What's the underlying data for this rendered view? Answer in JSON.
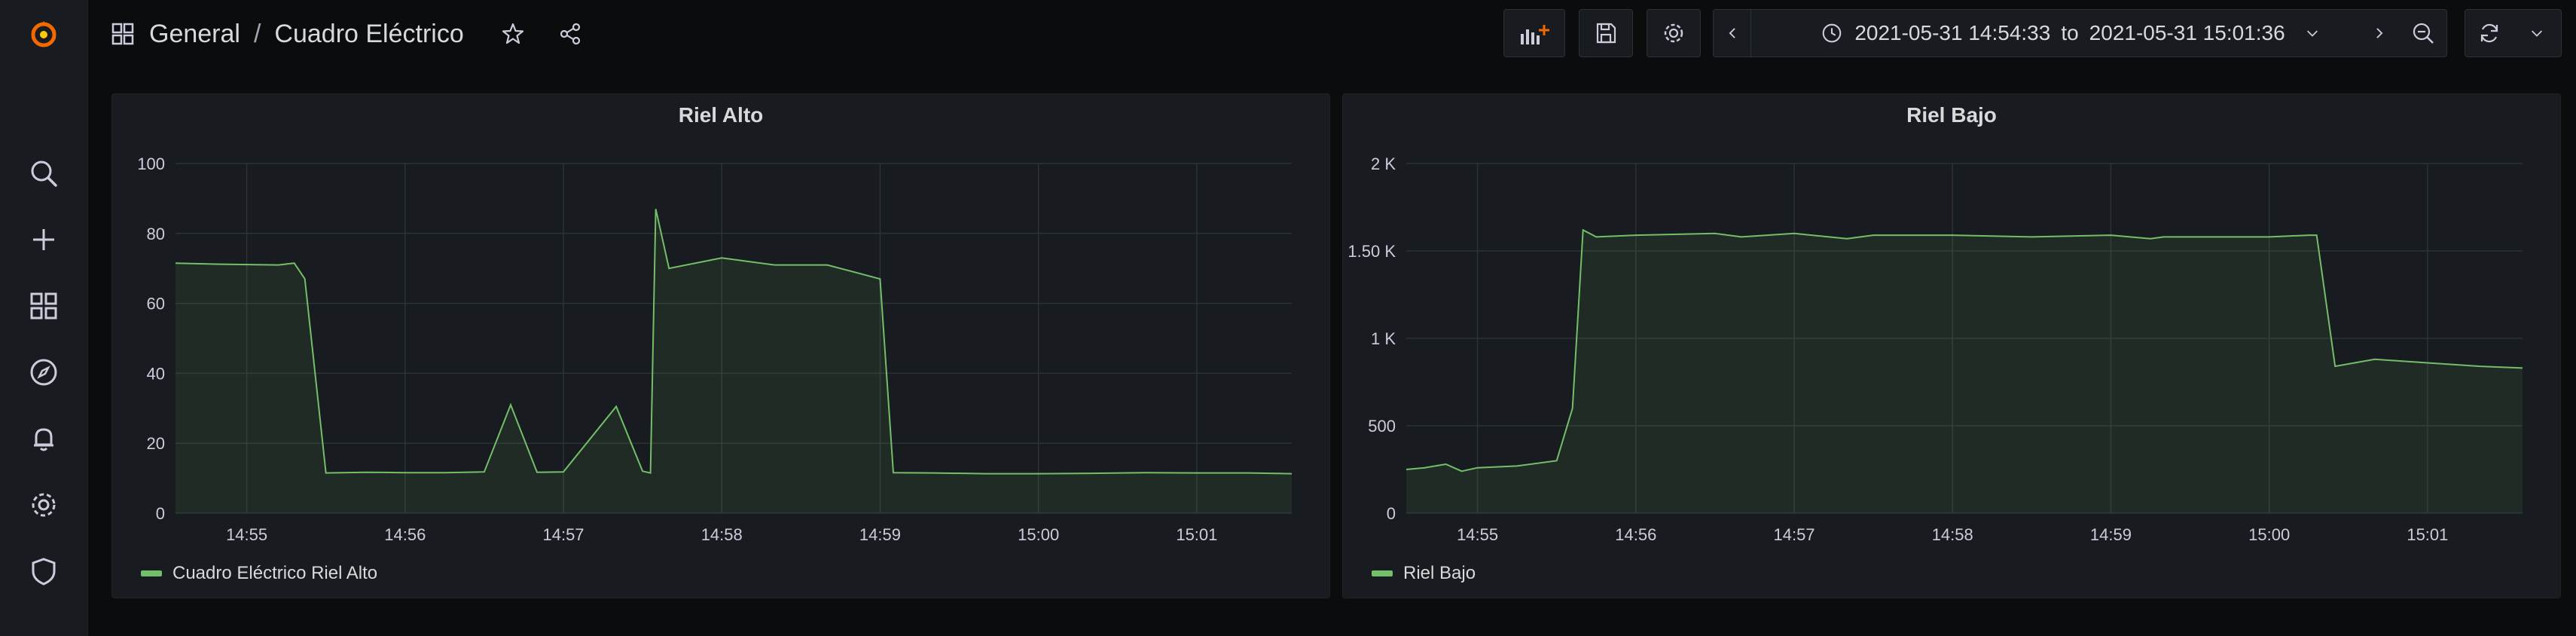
{
  "nav": {
    "items": [
      "search",
      "create",
      "dashboards",
      "explore",
      "alerting",
      "configuration",
      "server-admin"
    ]
  },
  "breadcrumb": {
    "folder": "General",
    "separator": "/",
    "dashboard": "Cuadro Eléctrico"
  },
  "time_range": {
    "from": "2021-05-31 14:54:33",
    "connector": "to",
    "to": "2021-05-31 15:01:36"
  },
  "colors": {
    "series": "#73bf69",
    "grid": "#2c3235",
    "panel_bg": "#181b1f",
    "page_bg": "#0b0c0e"
  },
  "panels": [
    {
      "title": "Riel Alto",
      "legend": "Cuadro Eléctrico Riel Alto"
    },
    {
      "title": "Riel Bajo",
      "legend": "Riel Bajo"
    }
  ],
  "chart_data": [
    {
      "type": "area",
      "title": "Riel Alto",
      "xlabel": "",
      "ylabel": "",
      "xlim": [
        "14:54:33",
        "15:01:36"
      ],
      "ylim": [
        0,
        100
      ],
      "x_ticks": [
        "14:55",
        "14:56",
        "14:57",
        "14:58",
        "14:59",
        "15:00",
        "15:01"
      ],
      "y_ticks": [
        "0",
        "20",
        "40",
        "60",
        "80",
        "100"
      ],
      "grid": true,
      "legend_position": "bottom-left",
      "series": [
        {
          "name": "Cuadro Eléctrico Riel Alto",
          "x": [
            "14:54:33",
            "14:54:50",
            "14:55:12",
            "14:55:18",
            "14:55:22",
            "14:55:30",
            "14:55:45",
            "14:56:00",
            "14:56:15",
            "14:56:30",
            "14:56:40",
            "14:56:50",
            "14:57:00",
            "14:57:20",
            "14:57:30",
            "14:57:33",
            "14:57:35",
            "14:57:40",
            "14:58:00",
            "14:58:20",
            "14:58:40",
            "14:59:00",
            "14:59:05",
            "14:59:20",
            "14:59:40",
            "15:00:00",
            "15:00:20",
            "15:00:40",
            "15:01:00",
            "15:01:20",
            "15:01:36"
          ],
          "y": [
            71.5,
            71.2,
            71,
            71.5,
            67,
            11.5,
            11.7,
            11.6,
            11.6,
            11.8,
            31,
            11.7,
            11.8,
            30.5,
            12,
            11.5,
            87,
            70,
            73,
            71,
            71,
            67,
            11.6,
            11.5,
            11.3,
            11.3,
            11.4,
            11.6,
            11.5,
            11.5,
            11.3
          ]
        }
      ]
    },
    {
      "type": "area",
      "title": "Riel Bajo",
      "xlabel": "",
      "ylabel": "",
      "xlim": [
        "14:54:33",
        "15:01:36"
      ],
      "ylim": [
        0,
        2000
      ],
      "x_ticks": [
        "14:55",
        "14:56",
        "14:57",
        "14:58",
        "14:59",
        "15:00",
        "15:01"
      ],
      "y_ticks": [
        "0",
        "500",
        "1 K",
        "1.50 K",
        "2 K"
      ],
      "grid": true,
      "legend_position": "bottom-left",
      "series": [
        {
          "name": "Riel Bajo",
          "x": [
            "14:54:33",
            "14:54:40",
            "14:54:48",
            "14:54:54",
            "14:55:00",
            "14:55:15",
            "14:55:30",
            "14:55:36",
            "14:55:40",
            "14:55:45",
            "14:56:00",
            "14:56:30",
            "14:56:40",
            "14:57:00",
            "14:57:20",
            "14:57:30",
            "14:58:00",
            "14:58:30",
            "14:59:00",
            "14:59:15",
            "14:59:20",
            "15:00:00",
            "15:00:15",
            "15:00:18",
            "15:00:25",
            "15:00:40",
            "15:01:00",
            "15:01:20",
            "15:01:36"
          ],
          "y": [
            250,
            260,
            280,
            240,
            260,
            270,
            300,
            600,
            1620,
            1580,
            1590,
            1600,
            1580,
            1600,
            1570,
            1590,
            1590,
            1580,
            1590,
            1570,
            1580,
            1580,
            1590,
            1590,
            840,
            880,
            860,
            840,
            830
          ]
        }
      ]
    }
  ]
}
